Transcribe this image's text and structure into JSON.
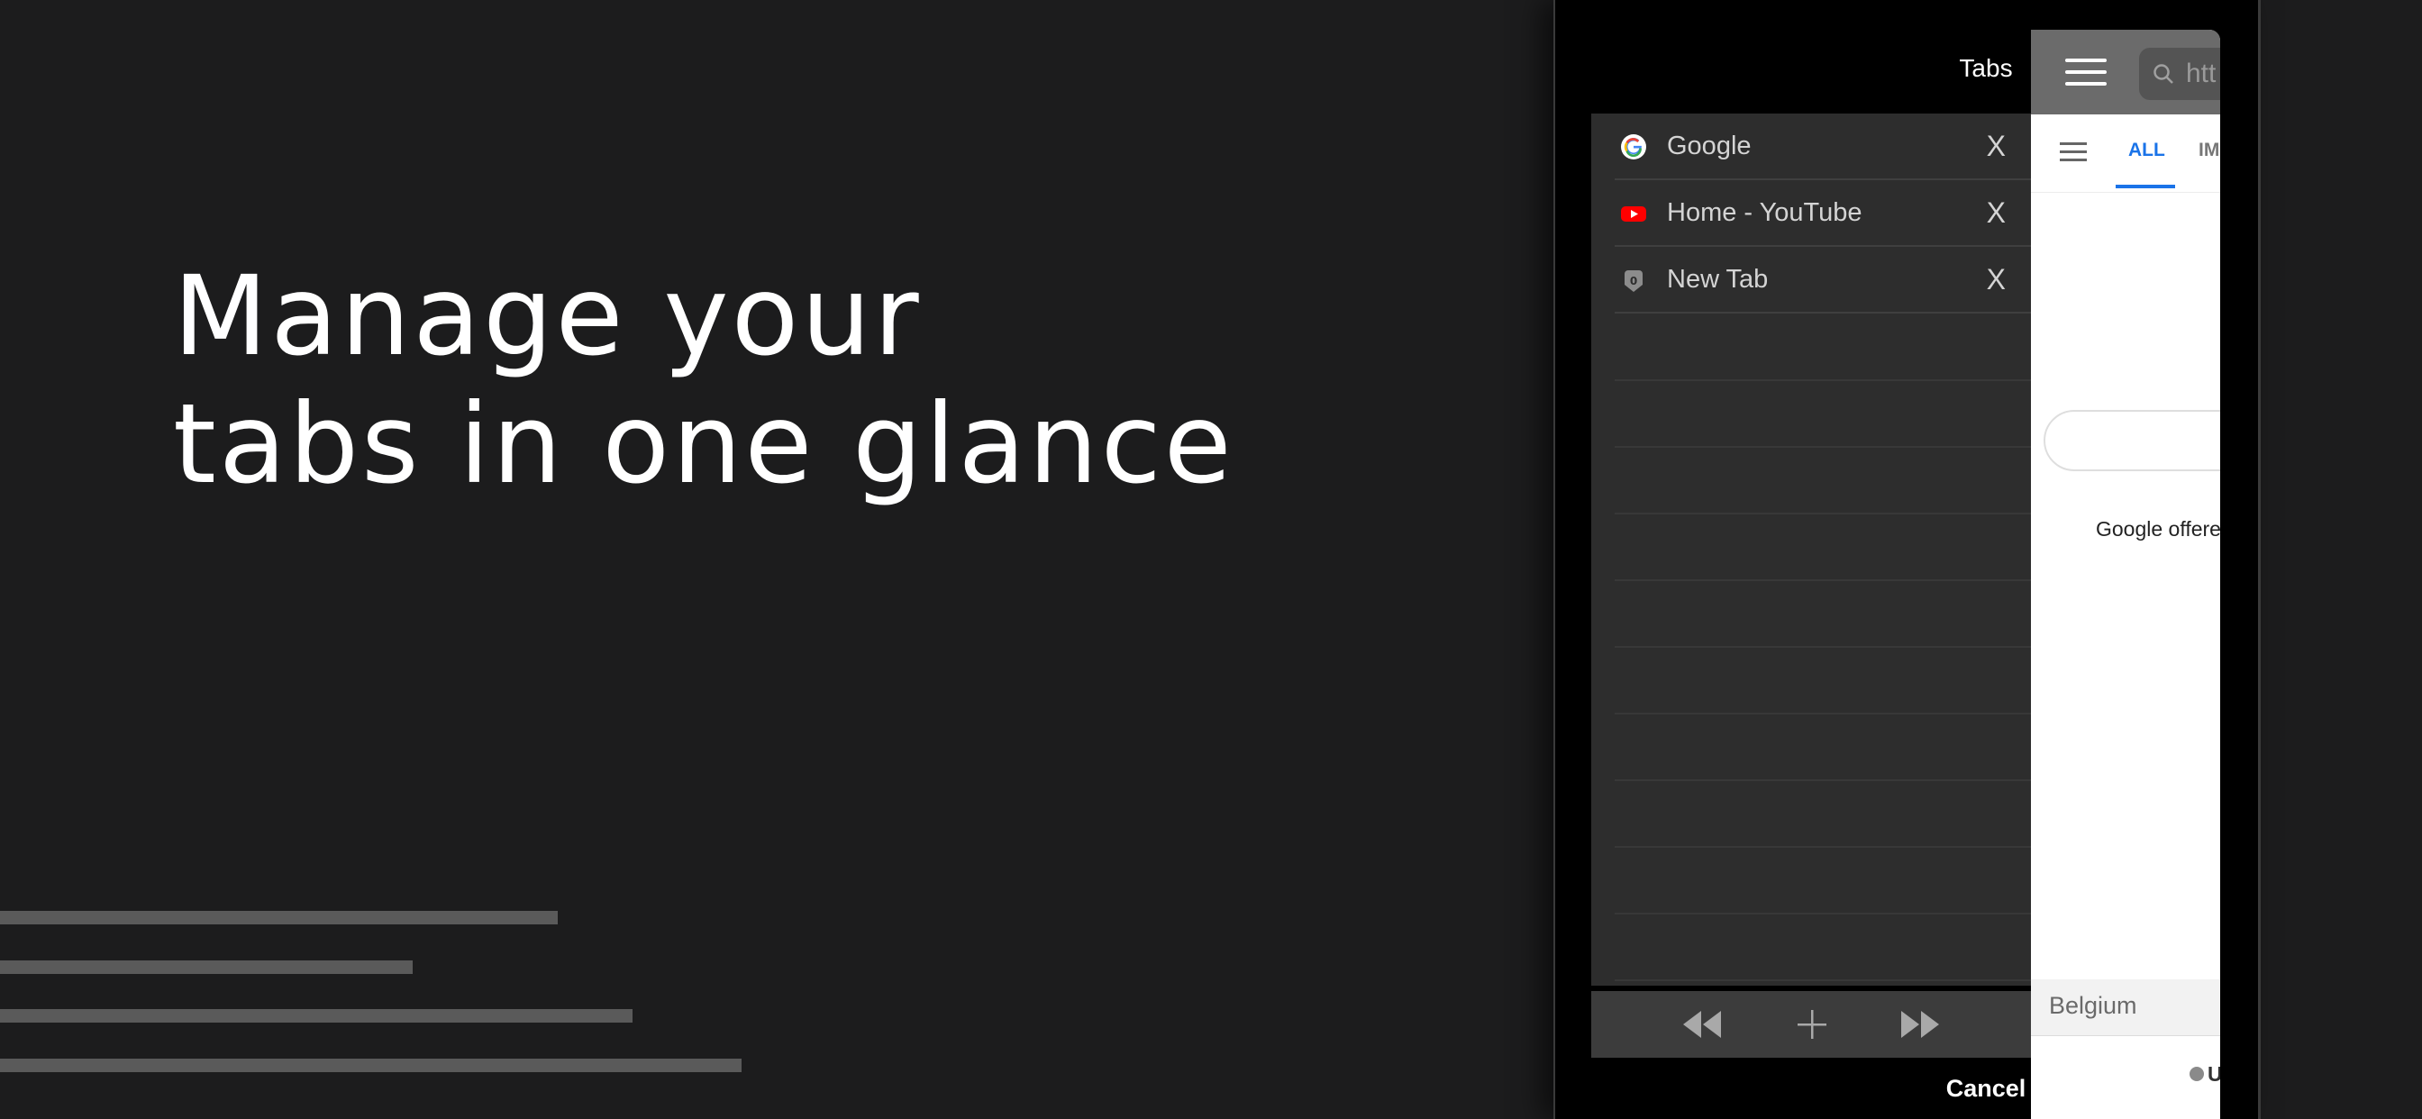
{
  "promo": {
    "headline_line1": "Manage your",
    "headline_line2": "tabs in one glance"
  },
  "tabs_sheet": {
    "title": "Tabs",
    "tabs": [
      {
        "title": "Google",
        "icon": "google-favicon",
        "close_label": "X"
      },
      {
        "title": "Home - YouTube",
        "icon": "youtube-favicon",
        "close_label": "X"
      },
      {
        "title": "New Tab",
        "icon": "new-tab-favicon",
        "icon_text": "0",
        "close_label": "X"
      }
    ],
    "toolbar": {
      "back_icon": "rewind-icon",
      "add_icon": "plus-icon",
      "forward_icon": "fast-forward-icon"
    },
    "cancel_label": "Cancel"
  },
  "web_preview": {
    "url_text": "htt",
    "nav_all": "ALL",
    "nav_im": "IM",
    "offered_text": "Google offered",
    "country": "Belgium",
    "footer_text": "U"
  },
  "colors": {
    "background": "#1c1c1d",
    "panel": "#2d2d2d",
    "accent_blue": "#1a73e8",
    "youtube_red": "#ff0000"
  }
}
